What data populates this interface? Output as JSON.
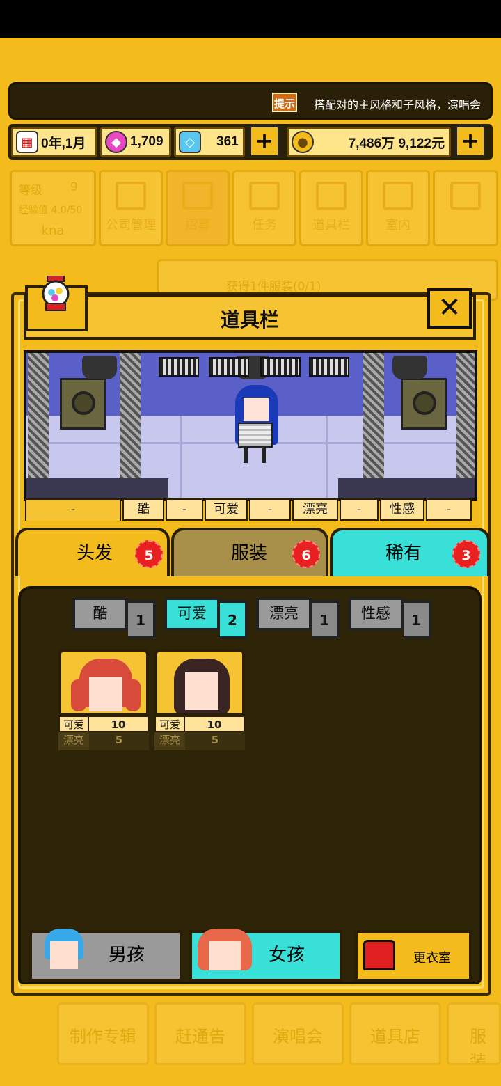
{
  "ticker": {
    "tip_badge": "提示",
    "text": "搭配对的主风格和子风格，演唱会"
  },
  "resources": {
    "date": "0年,1月",
    "gem_pink": "1,709",
    "gem_blue": "361",
    "money": "7,486万 9,122元"
  },
  "background_menu": {
    "level_label": "等级",
    "level_value": "9",
    "exp_label": "经验值 4.0/50",
    "name": "kna",
    "buttons": [
      "公司管理",
      "招募",
      "任务",
      "道具栏",
      "室内"
    ],
    "task_text": "获得1件服装(0/1)",
    "bottom": [
      "制作专辑",
      "赶通告",
      "演唱会",
      "道具店",
      "服装"
    ]
  },
  "modal": {
    "title": "道具栏",
    "close": "✕"
  },
  "style_row": [
    "-",
    "酷",
    "-",
    "可爱",
    "-",
    "漂亮",
    "-",
    "性感",
    "-"
  ],
  "tabs": [
    {
      "label": "头发",
      "badge": "5"
    },
    {
      "label": "服装",
      "badge": "6"
    },
    {
      "label": "稀有",
      "badge": "3"
    }
  ],
  "filters": [
    {
      "label": "酷",
      "count": "1"
    },
    {
      "label": "可爱",
      "count": "2"
    },
    {
      "label": "漂亮",
      "count": "1"
    },
    {
      "label": "性感",
      "count": "1"
    }
  ],
  "items": [
    {
      "stat1_name": "可爱",
      "stat1_value": "10",
      "stat2_name": "漂亮",
      "stat2_value": "5"
    },
    {
      "stat1_name": "可爱",
      "stat1_value": "10",
      "stat2_name": "漂亮",
      "stat2_value": "5"
    }
  ],
  "gender": {
    "boy": "男孩",
    "girl": "女孩",
    "dressing_room": "更衣室"
  },
  "colors": {
    "accent": "#f4bb1c",
    "active_teal": "#38e0d8",
    "badge_red": "#e82020",
    "panel_dark": "#2e2408"
  }
}
